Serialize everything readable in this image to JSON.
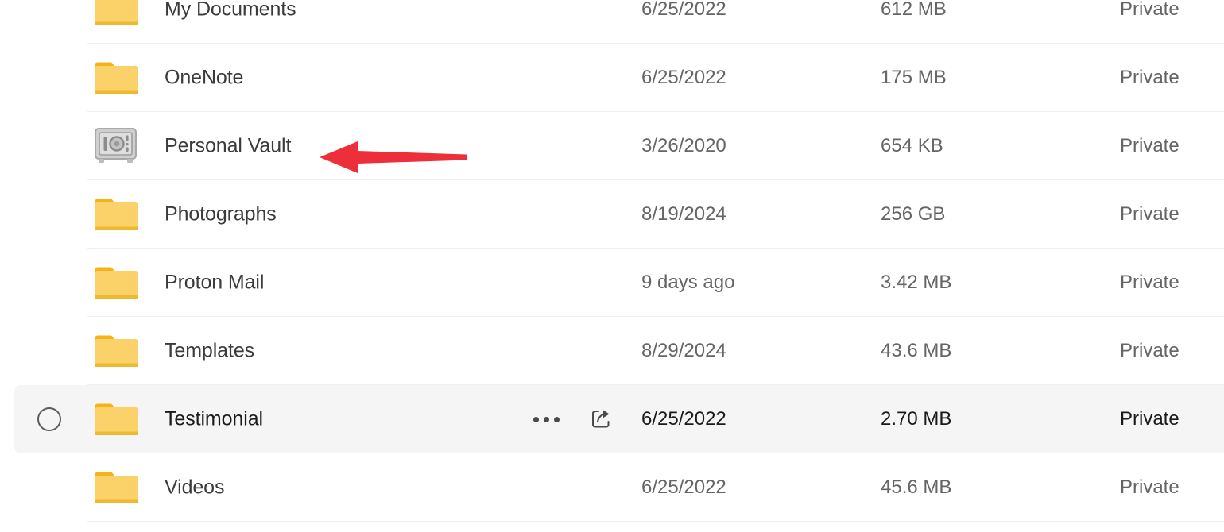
{
  "file_list": {
    "rows": [
      {
        "name": "My Documents",
        "icon": "folder-icon",
        "date": "6/25/2022",
        "size": "612 MB",
        "sharing": "Private",
        "hovered": false
      },
      {
        "name": "OneNote",
        "icon": "folder-icon",
        "date": "6/25/2022",
        "size": "175 MB",
        "sharing": "Private",
        "hovered": false
      },
      {
        "name": "Personal Vault",
        "icon": "vault-icon",
        "date": "3/26/2020",
        "size": "654 KB",
        "sharing": "Private",
        "hovered": false
      },
      {
        "name": "Photographs",
        "icon": "folder-icon",
        "date": "8/19/2024",
        "size": "256 GB",
        "sharing": "Private",
        "hovered": false
      },
      {
        "name": "Proton Mail",
        "icon": "folder-icon",
        "date": "9 days ago",
        "size": "3.42 MB",
        "sharing": "Private",
        "hovered": false
      },
      {
        "name": "Templates",
        "icon": "folder-icon",
        "date": "8/29/2024",
        "size": "43.6 MB",
        "sharing": "Private",
        "hovered": false
      },
      {
        "name": "Testimonial",
        "icon": "folder-icon",
        "date": "6/25/2022",
        "size": "2.70 MB",
        "sharing": "Private",
        "hovered": true
      },
      {
        "name": "Videos",
        "icon": "folder-icon",
        "date": "6/25/2022",
        "size": "45.6 MB",
        "sharing": "Private",
        "hovered": false
      }
    ],
    "row_actions": {
      "more_icon": "ellipsis-icon",
      "share_icon": "share-icon",
      "select_icon": "selection-circle-icon"
    }
  },
  "annotation": {
    "type": "arrow",
    "direction": "left",
    "color": "#ED2F3A",
    "points_at": "Personal Vault"
  },
  "colors": {
    "folder_body": "#FBD269",
    "folder_tab": "#F4B418",
    "folder_shadow": "#E9A91B",
    "vault_body": "#C6C6C6",
    "vault_detail": "#8C8C8C",
    "row_hover_bg": "#F5F5F5",
    "divider": "#F0F0F0",
    "text_primary": "#3B3B3B",
    "text_secondary": "#656565",
    "text_hovered": "#1B1B1B",
    "annotation_red": "#ED2F3A"
  }
}
